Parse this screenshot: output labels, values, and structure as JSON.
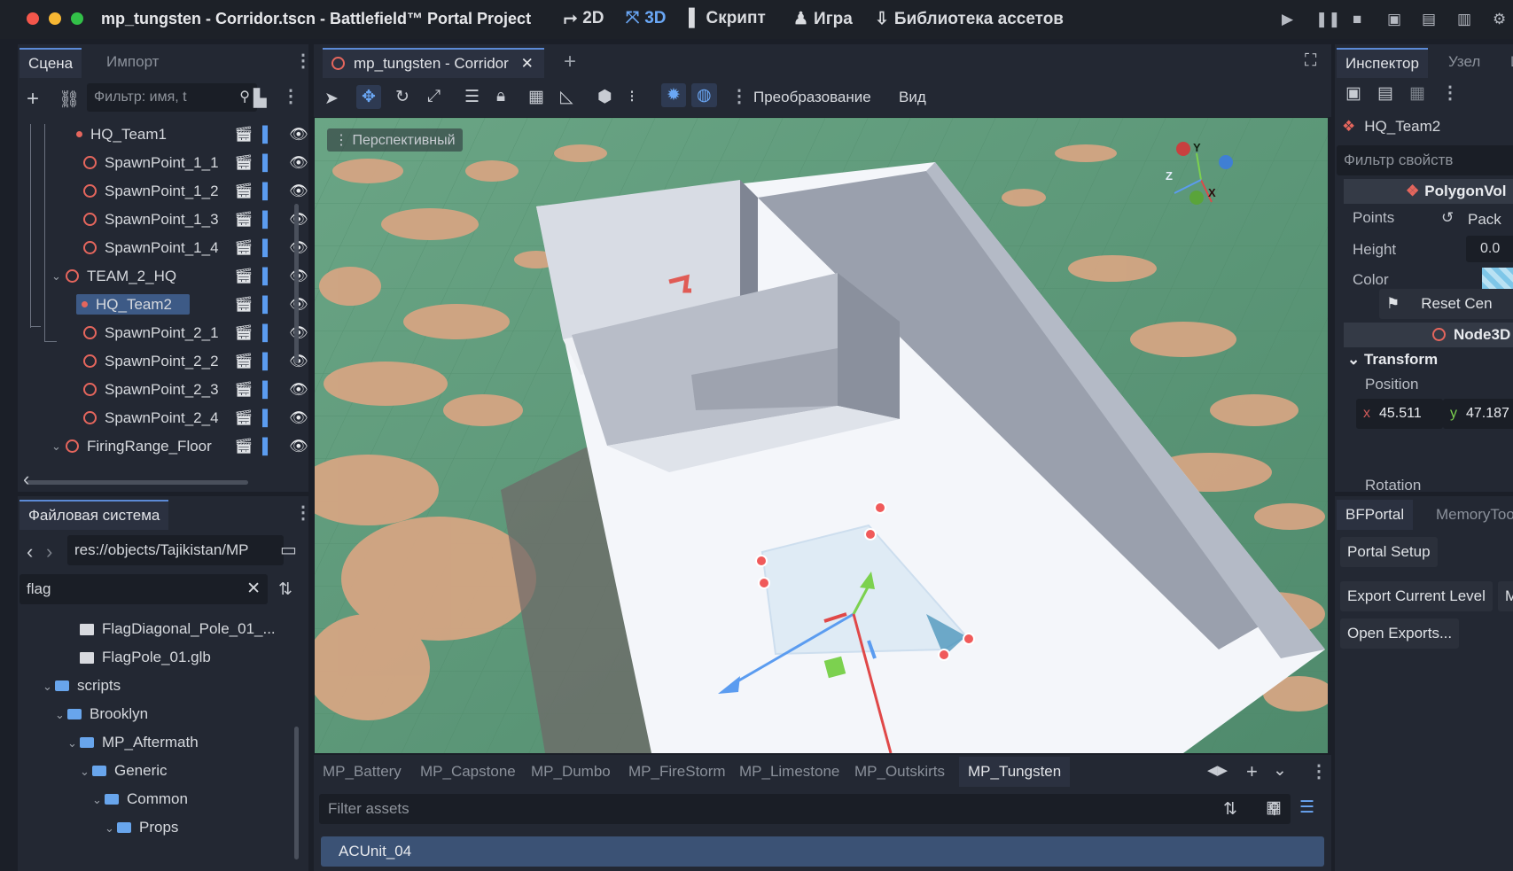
{
  "window": {
    "title": "mp_tungsten - Corridor.tscn - Battlefield™ Portal Project",
    "modes": [
      {
        "label": "2D",
        "icon": "2d-icon"
      },
      {
        "label": "3D",
        "icon": "3d-icon"
      },
      {
        "label": "Скрипт",
        "icon": "script-icon"
      },
      {
        "label": "Игра",
        "icon": "game-icon"
      },
      {
        "label": "Библиотека ассетов",
        "icon": "asset-library-icon"
      }
    ],
    "accent": "#5c8ad6"
  },
  "scene_dock": {
    "tabs": [
      "Сцена",
      "Импорт"
    ],
    "filter_placeholder": "Фильтр: имя, t",
    "items": [
      {
        "label": "HQ_Team1",
        "level": 1,
        "kind": "marker"
      },
      {
        "label": "SpawnPoint_1_1",
        "level": 2,
        "kind": "node"
      },
      {
        "label": "SpawnPoint_1_2",
        "level": 2,
        "kind": "node"
      },
      {
        "label": "SpawnPoint_1_3",
        "level": 2,
        "kind": "node"
      },
      {
        "label": "SpawnPoint_1_4",
        "level": 2,
        "kind": "node"
      },
      {
        "label": "TEAM_2_HQ",
        "level": 0,
        "kind": "node"
      },
      {
        "label": "HQ_Team2",
        "level": 1,
        "kind": "marker",
        "selected": true
      },
      {
        "label": "SpawnPoint_2_1",
        "level": 2,
        "kind": "node"
      },
      {
        "label": "SpawnPoint_2_2",
        "level": 2,
        "kind": "node"
      },
      {
        "label": "SpawnPoint_2_3",
        "level": 2,
        "kind": "node"
      },
      {
        "label": "SpawnPoint_2_4",
        "level": 2,
        "kind": "node"
      },
      {
        "label": "FiringRange_Floor",
        "level": 0,
        "kind": "node"
      }
    ]
  },
  "filesystem": {
    "title": "Файловая система",
    "path": "res://objects/Tajikistan/MP",
    "search": "flag",
    "items": [
      {
        "label": "FlagDiagonal_Pole_01_...",
        "type": "file",
        "indent": 3
      },
      {
        "label": "FlagPole_01.glb",
        "type": "file",
        "indent": 3
      },
      {
        "label": "scripts",
        "type": "folder",
        "indent": 1
      },
      {
        "label": "Brooklyn",
        "type": "folder",
        "indent": 2
      },
      {
        "label": "MP_Aftermath",
        "type": "folder",
        "indent": 3
      },
      {
        "label": "Generic",
        "type": "folder",
        "indent": 4
      },
      {
        "label": "Common",
        "type": "folder",
        "indent": 5
      },
      {
        "label": "Props",
        "type": "folder",
        "indent": 6
      }
    ]
  },
  "editor": {
    "tab_label": "mp_tungsten - Corridor",
    "toolbar_menus": [
      "Преобразование",
      "Вид"
    ],
    "viewport_label": "Перспективный",
    "gizmo_axes": [
      "Y",
      "Z",
      "X"
    ]
  },
  "asset_browser": {
    "tabs": [
      "MP_Battery",
      "MP_Capstone",
      "MP_Dumbo",
      "MP_FireStorm",
      "MP_Limestone",
      "MP_Outskirts",
      "MP_Tungsten"
    ],
    "active_tab": "MP_Tungsten",
    "filter_placeholder": "Filter assets",
    "rows": [
      "ACUnit_04"
    ]
  },
  "inspector": {
    "tabs": [
      "Инспектор",
      "Узел",
      "И"
    ],
    "node_name": "HQ_Team2",
    "filter_placeholder": "Фильтр свойств",
    "class_header": "PolygonVol",
    "props": {
      "points_label": "Points",
      "points_value": "Pack",
      "height_label": "Height",
      "height_value": "0.0",
      "color_label": "Color",
      "reset_label": "Reset Cen",
      "node3d_label": "Node3D",
      "transform_label": "Transform",
      "position_label": "Position",
      "pos_x_label": "x",
      "pos_x": "45.511",
      "pos_y_label": "y",
      "pos_y": "47.187",
      "rotation_label": "Rotation"
    }
  },
  "bfportal": {
    "tabs": [
      "BFPortal",
      "MemoryToo"
    ],
    "buttons": [
      "Portal Setup",
      "Export Current Level",
      "M",
      "Open Exports..."
    ]
  }
}
